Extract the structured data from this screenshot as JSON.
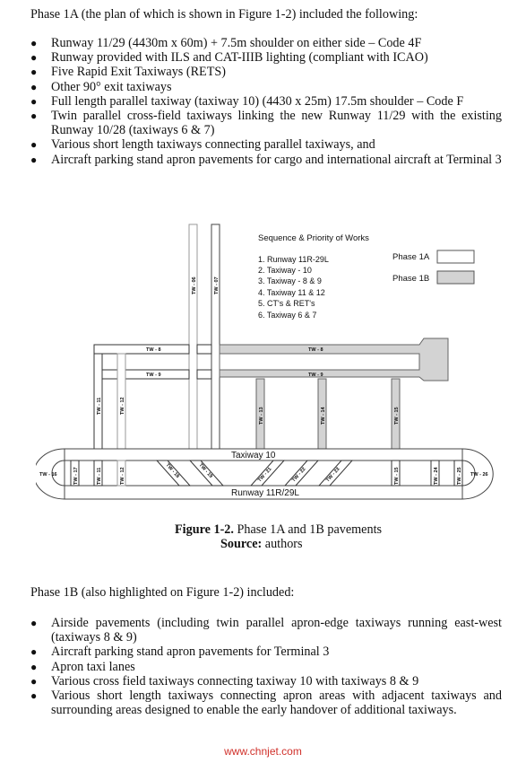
{
  "phase1a": {
    "intro": "Phase 1A (the plan of which is shown in Figure 1-2) included the following:",
    "items": [
      "Runway 11/29 (4430m x 60m) + 7.5m shoulder on either side – Code 4F",
      "Runway provided with ILS and CAT-IIIB lighting (compliant with ICAO)",
      "Five Rapid Exit Taxiways (RETS)",
      "Other 90° exit taxiways",
      "Full length parallel taxiway (taxiway 10) (4430 x 25m) 17.5m shoulder – Code F",
      "Twin parallel cross-field taxiways linking the new Runway 11/29 with the existing Runway 10/28 (taxiways 6 & 7)",
      "Various short length taxiways connecting parallel taxiways, and",
      "Aircraft parking stand apron pavements for cargo and international aircraft at Terminal 3"
    ]
  },
  "figure": {
    "legend_title": "Sequence & Priority of Works",
    "sequence": [
      "1. Runway 11R-29L",
      "2. Taxiway - 10",
      "3. Taxiway - 8 & 9",
      "4. Taxiway 11 & 12",
      "5. CT's & RET's",
      "6. Taxiway 6 & 7"
    ],
    "phases": [
      {
        "label": "Phase 1A",
        "color": "#ffffff"
      },
      {
        "label": "Phase 1B",
        "color": "#d3d3d3"
      }
    ],
    "labels": {
      "tw06": "TW - 06",
      "tw07": "TW - 07",
      "tw08": "TW - 8",
      "tw09": "TW - 9",
      "tw08b": "TW - 8",
      "tw09b": "TW - 9",
      "tw11": "TW - 11",
      "tw12": "TW - 12",
      "tw13": "TW - 13",
      "tw14": "TW - 14",
      "tw15": "TW - 15",
      "taxiway10": "Taxiway 10",
      "runway": "Runway 11R/29L",
      "tw16": "TW - 16",
      "tw17": "TW - 17",
      "tw11b": "TW - 11",
      "tw12b": "TW - 12",
      "tw18": "TW - 18",
      "tw19": "TW - 19",
      "tw21": "TW - 21",
      "tw22": "TW - 22",
      "tw23": "TW - 23",
      "tw15b": "TW - 15",
      "tw24": "TW - 24",
      "tw25": "TW - 25",
      "tw26": "TW - 26"
    },
    "caption_bold": "Figure 1-2.",
    "caption_text": " Phase 1A and 1B pavements",
    "source_bold": "Source:",
    "source_text": " authors"
  },
  "phase1b": {
    "intro": "Phase 1B (also highlighted on Figure 1-2) included:",
    "items": [
      "Airside pavements (including twin parallel apron-edge taxiways running east-west (taxiways 8 & 9)",
      "Aircraft parking stand apron pavements for Terminal 3",
      "Apron taxi lanes",
      "Various cross field taxiways connecting taxiway 10 with taxiways 8 & 9",
      "Various short length taxiways connecting apron areas with adjacent taxiways and surrounding areas designed to enable the early handover of additional taxiways."
    ]
  },
  "watermark": "www.chnjet.com"
}
